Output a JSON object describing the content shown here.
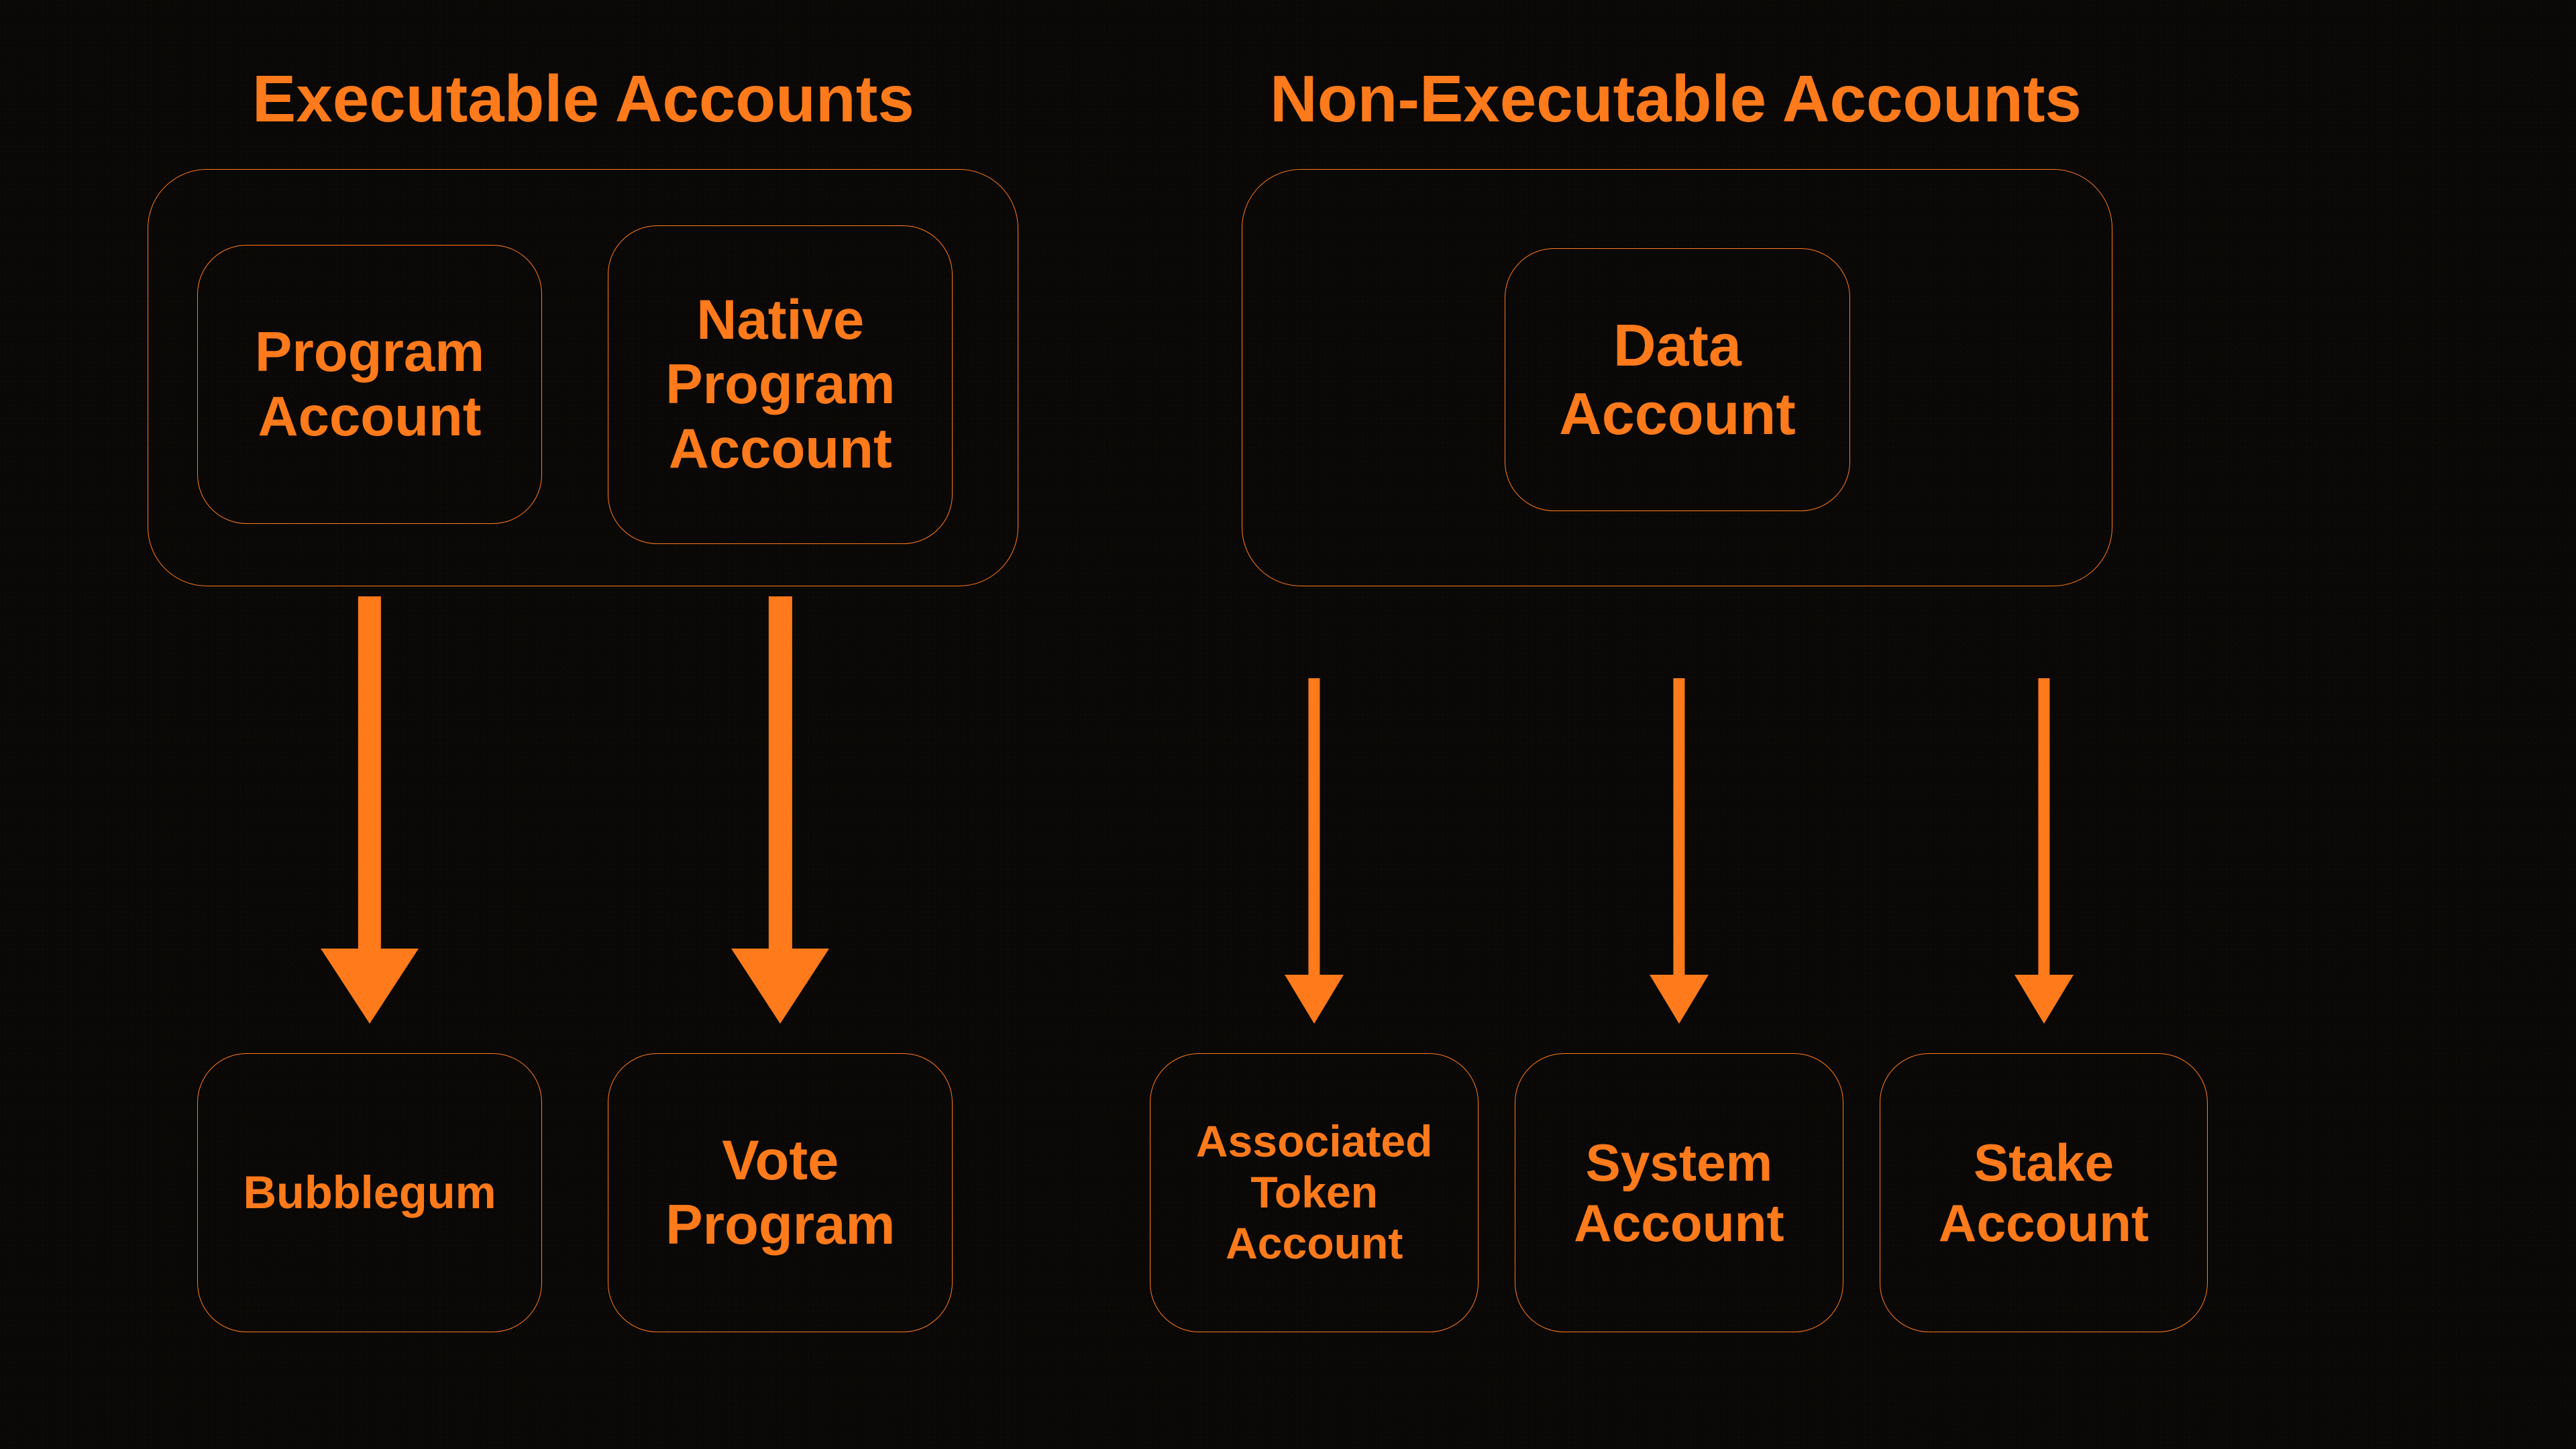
{
  "colors": {
    "accent": "#ff7a1a",
    "bg": "#0a0806"
  },
  "left": {
    "title": "Executable Accounts",
    "top_nodes": [
      {
        "id": "program-account",
        "label": "Program\nAccount"
      },
      {
        "id": "native-program-account",
        "label": "Native\nProgram\nAccount"
      }
    ],
    "bottom_nodes": [
      {
        "id": "bubblegum",
        "label": "Bubblegum"
      },
      {
        "id": "vote-program",
        "label": "Vote\nProgram"
      }
    ]
  },
  "right": {
    "title": "Non-Executable Accounts",
    "top_nodes": [
      {
        "id": "data-account",
        "label": "Data\nAccount"
      }
    ],
    "bottom_nodes": [
      {
        "id": "associated-token-account",
        "label": "Associated\nToken\nAccount"
      },
      {
        "id": "system-account",
        "label": "System\nAccount"
      },
      {
        "id": "stake-account",
        "label": "Stake\nAccount"
      }
    ]
  },
  "edges": [
    {
      "from": "program-account",
      "to": "bubblegum",
      "style": "thick"
    },
    {
      "from": "native-program-account",
      "to": "vote-program",
      "style": "thick"
    },
    {
      "from": "data-account",
      "to": "associated-token-account",
      "style": "thin"
    },
    {
      "from": "data-account",
      "to": "system-account",
      "style": "thin"
    },
    {
      "from": "data-account",
      "to": "stake-account",
      "style": "thin"
    }
  ]
}
